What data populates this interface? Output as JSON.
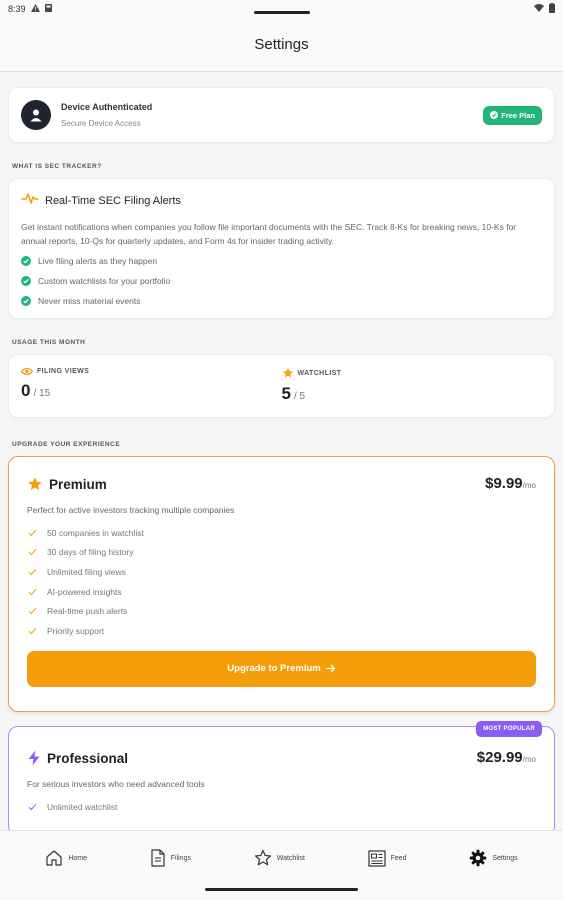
{
  "status_bar": {
    "time": "8:39"
  },
  "header": {
    "title": "Settings"
  },
  "auth": {
    "title": "Device Authenticated",
    "subtitle": "Secure Device Access",
    "badge": "Free Plan"
  },
  "about": {
    "section_label": "WHAT IS SEC TRACKER?",
    "title": "Real-Time SEC Filing Alerts",
    "description": "Get instant notifications when companies you follow file important documents with the SEC. Track 8-Ks for breaking news, 10-Ks for annual reports, 10-Qs for quarterly updates, and Form 4s for insider trading activity.",
    "features": [
      "Live filing alerts as they happen",
      "Custom watchlists for your portfolio",
      "Never miss material events"
    ]
  },
  "usage": {
    "section_label": "USAGE THIS MONTH",
    "filing_views": {
      "label": "FILING VIEWS",
      "value": "0",
      "max": "/ 15"
    },
    "watchlist": {
      "label": "WATCHLIST",
      "value": "5",
      "max": "/ 5"
    }
  },
  "upgrade": {
    "section_label": "UPGRADE YOUR EXPERIENCE",
    "premium": {
      "name": "Premium",
      "price": "$9.99",
      "period": "/mo",
      "description": "Perfect for active investors tracking multiple companies",
      "features": [
        "50 companies in watchlist",
        "30 days of filing history",
        "Unlimited filing views",
        "AI-powered insights",
        "Real-time push alerts",
        "Priority support"
      ],
      "button": "Upgrade to Premium"
    },
    "professional": {
      "badge": "MOST POPULAR",
      "name": "Professional",
      "price": "$29.99",
      "period": "/mo",
      "description": "For serious investors who need advanced tools",
      "features": [
        "Unlimited watchlist"
      ]
    }
  },
  "nav": {
    "items": [
      {
        "label": "Home",
        "icon": "home-icon"
      },
      {
        "label": "Filings",
        "icon": "document-icon"
      },
      {
        "label": "Watchlist",
        "icon": "star-icon"
      },
      {
        "label": "Feed",
        "icon": "newspaper-icon"
      },
      {
        "label": "Settings",
        "icon": "gear-icon"
      }
    ]
  },
  "colors": {
    "accent_green": "#22b57a",
    "premium_orange": "#f59e0b",
    "professional_purple": "#8b5cf6"
  }
}
